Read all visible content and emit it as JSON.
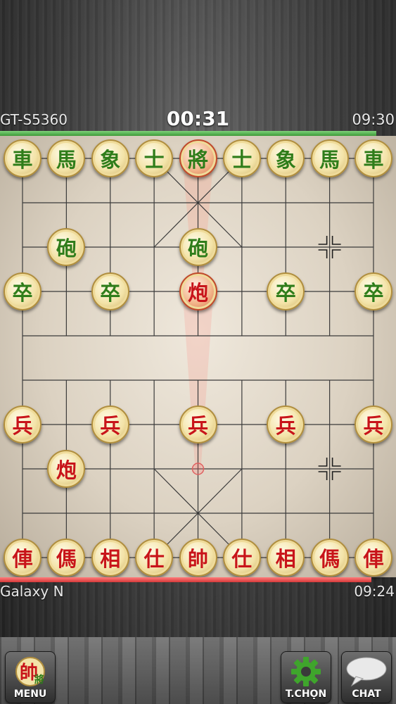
{
  "top_player": {
    "name": "GT-S5360",
    "clock": "09:30"
  },
  "turn_timer": "00:31",
  "bottom_player": {
    "name": "Galaxy N",
    "clock": "09:24"
  },
  "colors": {
    "top_bar": "#4fae4a",
    "bottom_bar": "#e04a4a",
    "green_piece": "#2f7d1a",
    "red_piece": "#c8141a"
  },
  "pieces": [
    {
      "char": "車",
      "side": "green",
      "file": 0,
      "rank": 0
    },
    {
      "char": "馬",
      "side": "green",
      "file": 1,
      "rank": 0
    },
    {
      "char": "象",
      "side": "green",
      "file": 2,
      "rank": 0
    },
    {
      "char": "士",
      "side": "green",
      "file": 3,
      "rank": 0
    },
    {
      "char": "將",
      "side": "green",
      "file": 4,
      "rank": 0,
      "selected": true
    },
    {
      "char": "士",
      "side": "green",
      "file": 5,
      "rank": 0
    },
    {
      "char": "象",
      "side": "green",
      "file": 6,
      "rank": 0
    },
    {
      "char": "馬",
      "side": "green",
      "file": 7,
      "rank": 0
    },
    {
      "char": "車",
      "side": "green",
      "file": 8,
      "rank": 0
    },
    {
      "char": "砲",
      "side": "green",
      "file": 1,
      "rank": 2
    },
    {
      "char": "砲",
      "side": "green",
      "file": 4,
      "rank": 2
    },
    {
      "char": "卒",
      "side": "green",
      "file": 0,
      "rank": 3
    },
    {
      "char": "卒",
      "side": "green",
      "file": 2,
      "rank": 3
    },
    {
      "char": "炮",
      "side": "red",
      "file": 4,
      "rank": 3,
      "selected": true
    },
    {
      "char": "卒",
      "side": "green",
      "file": 6,
      "rank": 3
    },
    {
      "char": "卒",
      "side": "green",
      "file": 8,
      "rank": 3
    },
    {
      "char": "兵",
      "side": "red",
      "file": 0,
      "rank": 6
    },
    {
      "char": "兵",
      "side": "red",
      "file": 2,
      "rank": 6
    },
    {
      "char": "兵",
      "side": "red",
      "file": 4,
      "rank": 6
    },
    {
      "char": "兵",
      "side": "red",
      "file": 6,
      "rank": 6
    },
    {
      "char": "兵",
      "side": "red",
      "file": 8,
      "rank": 6
    },
    {
      "char": "炮",
      "side": "red",
      "file": 1,
      "rank": 7
    },
    {
      "char": "俥",
      "side": "red",
      "file": 0,
      "rank": 9
    },
    {
      "char": "傌",
      "side": "red",
      "file": 1,
      "rank": 9
    },
    {
      "char": "相",
      "side": "red",
      "file": 2,
      "rank": 9
    },
    {
      "char": "仕",
      "side": "red",
      "file": 3,
      "rank": 9
    },
    {
      "char": "帥",
      "side": "red",
      "file": 4,
      "rank": 9
    },
    {
      "char": "仕",
      "side": "red",
      "file": 5,
      "rank": 9
    },
    {
      "char": "相",
      "side": "red",
      "file": 6,
      "rank": 9
    },
    {
      "char": "傌",
      "side": "red",
      "file": 7,
      "rank": 9
    },
    {
      "char": "俥",
      "side": "red",
      "file": 8,
      "rank": 9
    }
  ],
  "last_move": {
    "from": {
      "file": 4,
      "rank": 7
    },
    "to": {
      "file": 4,
      "rank": 3
    }
  },
  "position_markers": [
    {
      "file": 7,
      "rank": 2
    },
    {
      "file": 7,
      "rank": 7
    }
  ],
  "buttons": {
    "menu": "MENU",
    "options": "T.CHỌN",
    "chat": "CHAT"
  },
  "icons": {
    "menu": "shuai-jiang-piece-icon",
    "options": "gear-icon",
    "chat": "speech-bubble-icon"
  }
}
